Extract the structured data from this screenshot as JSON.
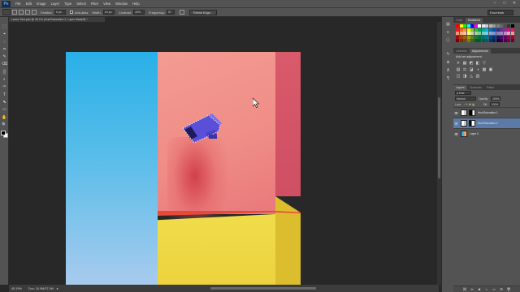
{
  "app": {
    "logo": "Ps"
  },
  "menu": [
    "File",
    "Edit",
    "Image",
    "Layer",
    "Type",
    "Select",
    "Filter",
    "View",
    "Window",
    "Help"
  ],
  "window_controls": [
    "–",
    "□",
    "✕"
  ],
  "options": {
    "feather_label": "Feather:",
    "feather_value": "0 px",
    "antialias_label": "Anti-alias",
    "width_label": "Width:",
    "width_value": "10 px",
    "contrast_label": "Contrast:",
    "contrast_value": "10%",
    "frequency_label": "Frequency:",
    "frequency_value": "57",
    "refine_label": "Refine Edge...",
    "workspace": "Essentials"
  },
  "document": {
    "tab_title": "Lance Test.psd @ 45.1% (Hue/Saturation 2, Layer Mask/8) *"
  },
  "status": {
    "zoom": "45.19%",
    "doc_size": "Doc: 24.9M/37.0M",
    "arrow": "▸"
  },
  "tools": [
    "⬚",
    "⌖",
    "◌",
    "⌗",
    "✎",
    "⌫",
    "▒",
    "◐",
    "✑",
    "T",
    "⬉",
    "▭",
    "✋",
    "🔍"
  ],
  "tool_names": [
    "marquee-icon",
    "move-icon",
    "lasso-icon",
    "crop-icon",
    "brush-icon",
    "eraser-icon",
    "gradient-icon",
    "dodge-icon",
    "pen-icon",
    "type-icon",
    "path-select-icon",
    "shape-icon",
    "hand-icon",
    "zoom-icon"
  ],
  "swatches_panel": {
    "tabs": [
      "Color",
      "Swatches"
    ],
    "active": 1,
    "colors": [
      "#ff0000",
      "#ffff00",
      "#00ff00",
      "#00ffff",
      "#0000ff",
      "#ff00ff",
      "#ffffff",
      "#e6e6e6",
      "#cccccc",
      "#b3b3b3",
      "#999999",
      "#808080",
      "#666666",
      "#4d4d4d",
      "#333333",
      "#000000",
      "#ed1c24",
      "#f26522",
      "#f7941d",
      "#fff200",
      "#8dc63f",
      "#39b54a",
      "#00a651",
      "#00a99d",
      "#00aeef",
      "#0072bc",
      "#0054a6",
      "#2e3192",
      "#662d91",
      "#92278f",
      "#ec008c",
      "#ed145b",
      "#f69679",
      "#f9ad81",
      "#fdc689",
      "#fff799",
      "#c4df9b",
      "#a3d39c",
      "#82ca9c",
      "#7accc8",
      "#6dcff6",
      "#7da7d9",
      "#8393ca",
      "#8781bd",
      "#a186be",
      "#bd8cbf",
      "#f49ac1",
      "#f5989d",
      "#9e0b0f",
      "#a0410d",
      "#a36209",
      "#aba000",
      "#598527",
      "#1a7b30",
      "#007236",
      "#00746b",
      "#0076a3",
      "#004b80",
      "#003471",
      "#1b1464",
      "#440e62",
      "#630460",
      "#9e005d",
      "#9e0039",
      "#790000",
      "#7b2e00",
      "#7d4900",
      "#827b00",
      "#406618",
      "#005e20",
      "#005826",
      "#005952",
      "#005b7f",
      "#003663",
      "#002157",
      "#0d004c",
      "#32004b",
      "#4b0049",
      "#7b0046",
      "#7a0026"
    ]
  },
  "adjustments_panel": {
    "tabs": [
      "Libraries",
      "Adjustments"
    ],
    "active": 1,
    "title": "Add an adjustment",
    "row1": [
      "☀",
      "▦",
      "◩",
      "◧",
      "▽"
    ],
    "row2": [
      "▤",
      "⚖",
      "◪",
      "◑",
      "▩",
      "▣"
    ],
    "row3": [
      "◫",
      "◨",
      "◬",
      "▥"
    ]
  },
  "layers_panel": {
    "tabs": [
      "Layers",
      "Channels",
      "Paths"
    ],
    "active": 0,
    "kind": "ρ Kind",
    "blend_mode": "Normal",
    "opacity_label": "Opacity:",
    "opacity_value": "100%",
    "lock_label": "Lock:",
    "fill_label": "Fill:",
    "fill_value": "100%",
    "layers": [
      {
        "name": "Hue/Saturation 1",
        "selected": false
      },
      {
        "name": "Hue/Saturation 2",
        "selected": true
      },
      {
        "name": "Layer 0",
        "selected": false
      }
    ],
    "bottom_icons": [
      "⛓",
      "fx",
      "◙",
      "◐",
      "▭",
      "⊞",
      "🗑"
    ]
  },
  "colors": {
    "ui_dark": "#282828",
    "panel": "#535353",
    "selection": "#5b7aa6",
    "camera": "#5a4fd8"
  }
}
